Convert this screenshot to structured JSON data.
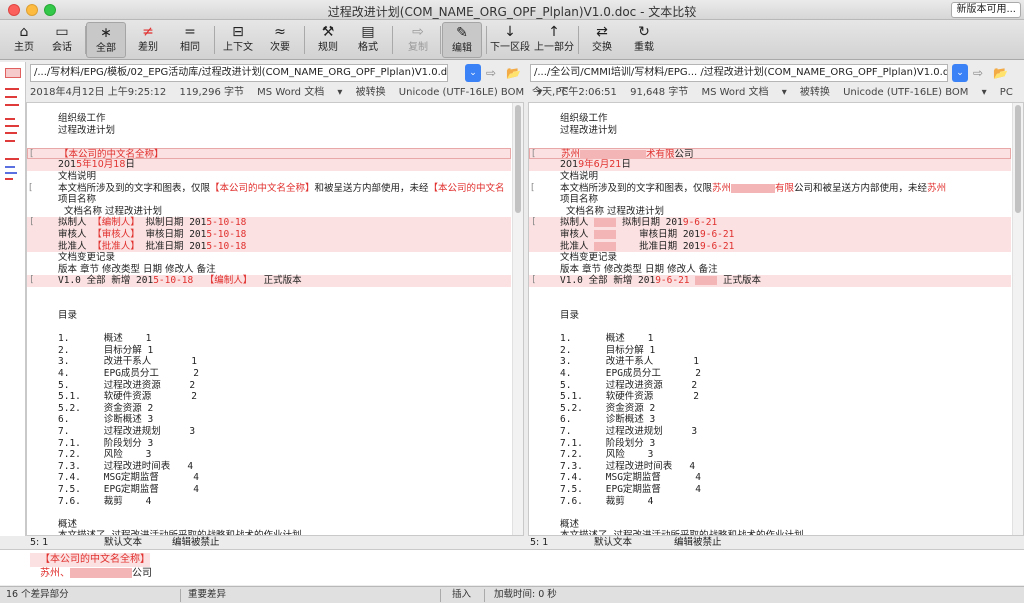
{
  "window": {
    "title": "过程改进计划(COM_NAME_ORG_OPF_Plplan)V1.0.doc - 文本比较",
    "new_version_label": "新版本可用..."
  },
  "toolbar": [
    {
      "label": "主页",
      "icon": "home-icon",
      "glyph": "⌂"
    },
    {
      "label": "会话",
      "icon": "session-icon",
      "glyph": "▭"
    },
    {
      "label": "全部",
      "icon": "all-icon",
      "glyph": "∗",
      "active": true
    },
    {
      "label": "差别",
      "icon": "diffs-icon",
      "glyph": "≠"
    },
    {
      "label": "相同",
      "icon": "same-icon",
      "glyph": "="
    },
    {
      "label": "上下文",
      "icon": "context-icon",
      "glyph": "⊟"
    },
    {
      "label": "次要",
      "icon": "minor-icon",
      "glyph": "≈"
    },
    {
      "label": "规则",
      "icon": "rules-icon",
      "glyph": "⚒"
    },
    {
      "label": "格式",
      "icon": "format-icon",
      "glyph": "▤"
    },
    {
      "label": "复制",
      "icon": "copy-icon",
      "glyph": "⇨",
      "dim": true
    },
    {
      "label": "编辑",
      "icon": "edit-icon",
      "glyph": "✎",
      "active": true
    },
    {
      "label": "下一区段",
      "icon": "next-section-icon",
      "glyph": "↓"
    },
    {
      "label": "上一部分",
      "icon": "prev-section-icon",
      "glyph": "↑"
    },
    {
      "label": "交换",
      "icon": "swap-icon",
      "glyph": "⇄"
    },
    {
      "label": "重载",
      "icon": "reload-icon",
      "glyph": "↻"
    }
  ],
  "left": {
    "path": "/.../写材料/EPG/模板/02_EPG活动库/过程改进计划(COM_NAME_ORG_OPF_Plplan)V1.0.doc",
    "info": {
      "date": "2018年4月12日 上午9:25:12",
      "size": "119,296 字节",
      "doctype": "MS Word 文档",
      "converted": "被转换",
      "encoding": "Unicode (UTF-16LE) BOM",
      "os": "PC"
    },
    "status": {
      "pos": "5: 1",
      "mode": "默认文本",
      "edit": "编辑被禁止"
    }
  },
  "right": {
    "path": "/.../全公司/CMMI培训/写材料/EPG...        /过程改进计划(COM_NAME_ORG_OPF_Plplan)V1.0.d...",
    "info": {
      "date": "今天, 下午2:06:51",
      "size": "91,648 字节",
      "doctype": "MS Word 文档",
      "converted": "被转换",
      "encoding": "Unicode (UTF-16LE) BOM",
      "os": "PC"
    },
    "status": {
      "pos": "5: 1",
      "mode": "默认文本",
      "edit": "编辑被禁止"
    }
  },
  "bottom": {
    "line1": "【本公司的中文名全称】",
    "line2_prefix": "苏州、",
    "line2_suffix": "公司"
  },
  "statusbar": {
    "diffs": "16 个差异部分",
    "important": "重要差异",
    "insert": "插入",
    "load_time": "加载时间: 0 秒"
  }
}
